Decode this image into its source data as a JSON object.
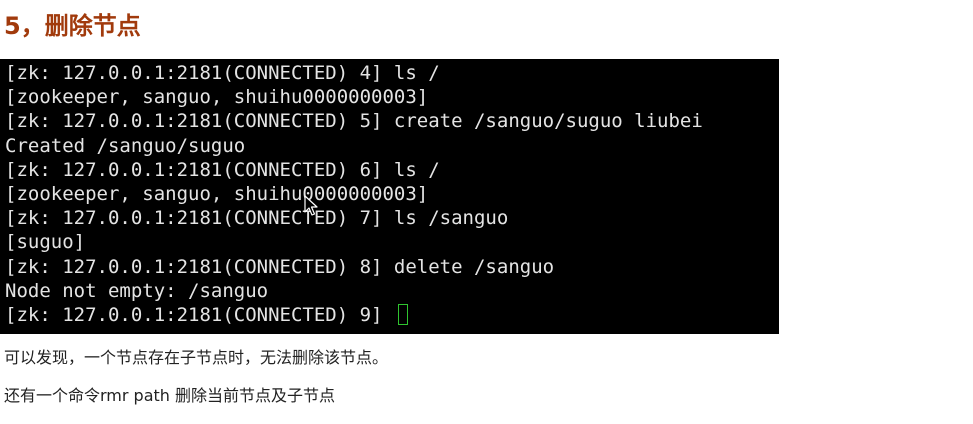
{
  "heading": "5，删除节点",
  "terminal": {
    "lines": [
      "[zk: 127.0.0.1:2181(CONNECTED) 4] ls /",
      "[zookeeper, sanguo, shuihu0000000003]",
      "[zk: 127.0.0.1:2181(CONNECTED) 5] create /sanguo/suguo liubei",
      "Created /sanguo/suguo",
      "[zk: 127.0.0.1:2181(CONNECTED) 6] ls /",
      "[zookeeper, sanguo, shuihu0000000003]",
      "[zk: 127.0.0.1:2181(CONNECTED) 7] ls /sanguo",
      "[suguo]",
      "[zk: 127.0.0.1:2181(CONNECTED) 8] delete /sanguo",
      "Node not empty: /sanguo",
      "[zk: 127.0.0.1:2181(CONNECTED) 9] "
    ],
    "text_color": "#e4e4e4",
    "background": "#000000",
    "cursor_color": "#2fc42f"
  },
  "paragraphs": [
    "可以发现，一个节点存在子节点时，无法删除该节点。",
    "还有一个命令rmr path 删除当前节点及子节点"
  ],
  "colors": {
    "heading": "#a13a0c",
    "body_text": "#222222"
  },
  "icons": {
    "mouse_pointer": "arrow-cursor-icon"
  }
}
